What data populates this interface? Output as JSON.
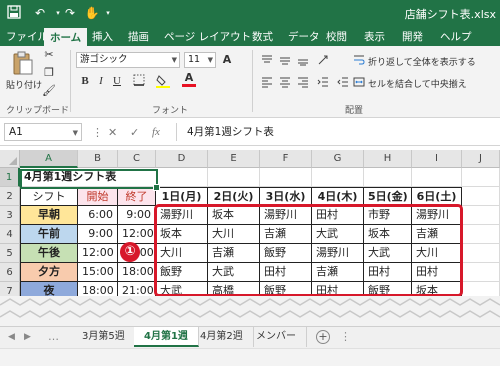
{
  "window": {
    "title": "店舗シフト表.xlsx"
  },
  "quick_access": {
    "save_icon": "save-icon",
    "undo_icon": "undo-icon",
    "redo_icon": "redo-icon",
    "touch_icon": "touch-mode-icon"
  },
  "ribbon_tabs": [
    "ファイル",
    "ホーム",
    "挿入",
    "描画",
    "ページ レイアウト",
    "数式",
    "データ",
    "校閲",
    "表示",
    "開発",
    "ヘルプ"
  ],
  "ribbon": {
    "paste_label": "貼り付け",
    "clipboard_label": "クリップボード",
    "font_label": "フォント",
    "alignment_label": "配置",
    "font_name": "游ゴシック",
    "font_size": "11",
    "font_buttons": [
      "B",
      "I",
      "U"
    ],
    "grow_font": "A",
    "wrap_text": "折り返して全体を表示する",
    "merge_center": "セルを結合して中央揃え"
  },
  "formula_bar": {
    "name_box": "A1",
    "fx": "fx",
    "content": "4月第1週シフト表"
  },
  "grid": {
    "columns": [
      "A",
      "B",
      "C",
      "D",
      "E",
      "F",
      "G",
      "H",
      "I",
      "J"
    ],
    "rows": [
      "1",
      "2",
      "3",
      "4",
      "5",
      "6",
      "7"
    ],
    "title": "4月第1週シフト表",
    "headers": {
      "shift": "シフト",
      "start": "開始",
      "end": "終了",
      "days": [
        "1日(月)",
        "2日(火)",
        "3日(水)",
        "4日(木)",
        "5日(金)",
        "6日(土)"
      ]
    },
    "shifts": [
      {
        "name": "早朝",
        "start": "6:00",
        "end": "9:00",
        "staff": [
          "湯野川",
          "坂本",
          "湯野川",
          "田村",
          "市野",
          "湯野川"
        ]
      },
      {
        "name": "午前",
        "start": "9:00",
        "end": "12:00",
        "staff": [
          "坂本",
          "大川",
          "吉瀬",
          "大武",
          "坂本",
          "吉瀬"
        ]
      },
      {
        "name": "午後",
        "start": "12:00",
        "end": "15:00",
        "staff": [
          "大川",
          "吉瀬",
          "飯野",
          "湯野川",
          "大武",
          "大川"
        ]
      },
      {
        "name": "夕方",
        "start": "15:00",
        "end": "18:00",
        "staff": [
          "飯野",
          "大武",
          "田村",
          "吉瀬",
          "田村",
          "田村"
        ]
      },
      {
        "name": "夜",
        "start": "18:00",
        "end": "21:00",
        "staff": [
          "大武",
          "高橋",
          "飯野",
          "田村",
          "飯野",
          "坂本"
        ]
      }
    ],
    "callout": "①"
  },
  "colors": {
    "excel_green": "#217346",
    "highlight_red": "#d7182a",
    "shift_fills": [
      "#ffe699",
      "#bdd7ee",
      "#c6e0b4",
      "#f8cbad",
      "#8ea9db"
    ],
    "start_fill": "#fce4ec",
    "end_fill": "#fce4ec"
  },
  "sheet_tabs": [
    "3月第5週",
    "4月第1週",
    "4月第2週",
    "メンバー"
  ],
  "active_sheet": "4月第1週"
}
